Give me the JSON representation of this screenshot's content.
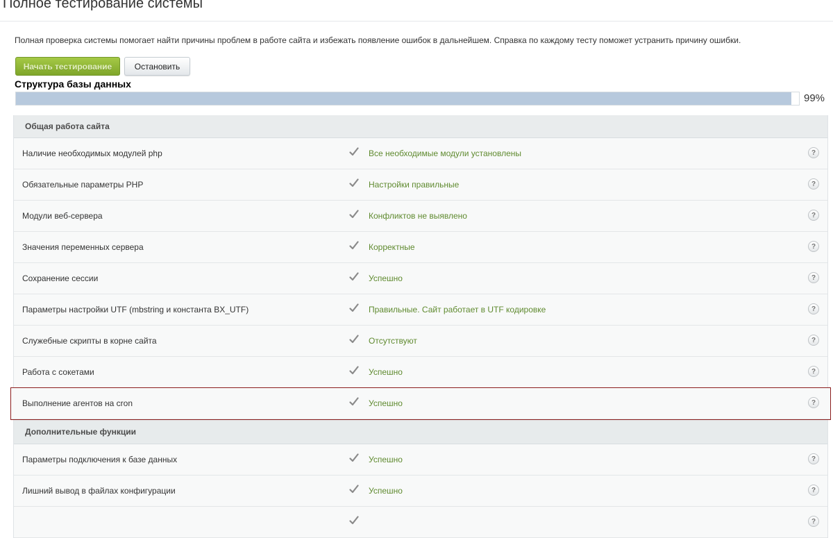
{
  "page": {
    "title": "Полное тестирование системы",
    "description": "Полная проверка системы помогает найти причины проблем в работе сайта и избежать появление ошибок в дальнейшем. Справка по каждому тесту поможет устранить причину ошибки."
  },
  "toolbar": {
    "start_label": "Начать тестирование",
    "stop_label": "Остановить"
  },
  "progress": {
    "current_test": "Структура базы данных",
    "percent_label": "99%",
    "value": 0.99
  },
  "colors": {
    "start_button": "#8db33a",
    "progress_fill": "#b7c9dd",
    "result_text": "#5f8a2f",
    "highlight_border": "#8b1c1c"
  },
  "groups": [
    {
      "title": "Общая работа сайта",
      "rows": [
        {
          "name": "Наличие необходимых модулей php",
          "result": "Все необходимые модули установлены",
          "icon": "check-icon"
        },
        {
          "name": "Обязательные параметры PHP",
          "result": "Настройки правильные",
          "icon": "check-icon"
        },
        {
          "name": "Модули веб-сервера",
          "result": "Конфликтов не выявлено",
          "icon": "check-icon"
        },
        {
          "name": "Значения переменных сервера",
          "result": "Корректные",
          "icon": "check-icon"
        },
        {
          "name": "Сохранение сессии",
          "result": "Успешно",
          "icon": "check-icon"
        },
        {
          "name": "Параметры настройки UTF (mbstring и константа BX_UTF)",
          "result": "Правильные. Сайт работает в UTF кодировке",
          "icon": "check-icon"
        },
        {
          "name": "Служебные скрипты в корне сайта",
          "result": "Отсутствуют",
          "icon": "check-icon"
        },
        {
          "name": "Работа с сокетами",
          "result": "Успешно",
          "icon": "check-icon"
        },
        {
          "name": "Выполнение агентов на cron",
          "result": "Успешно",
          "icon": "check-icon"
        }
      ]
    },
    {
      "title": "Дополнительные функции",
      "rows": [
        {
          "name": "Параметры подключения к базе данных",
          "result": "Успешно",
          "icon": "check-icon"
        },
        {
          "name": "Лишний вывод в файлах конфигурации",
          "result": "Успешно",
          "icon": "check-icon"
        }
      ]
    }
  ],
  "help_label": "?"
}
